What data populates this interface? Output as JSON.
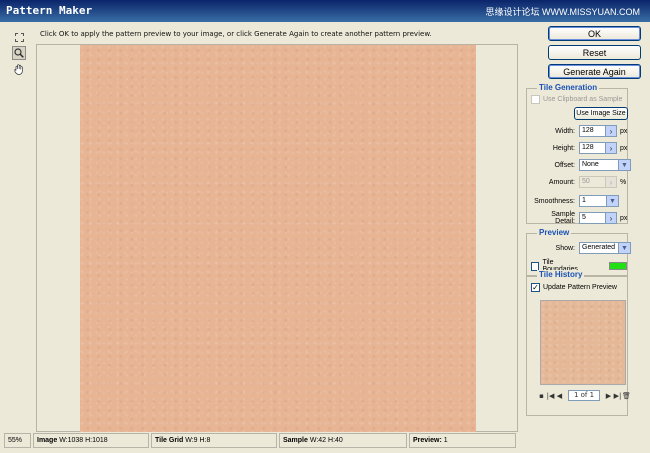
{
  "window": {
    "title": "Pattern Maker",
    "watermark": "思缘设计论坛  WWW.MISSYUAN.COM"
  },
  "toolbar": {
    "tools": [
      {
        "name": "rectangular-marquee-icon",
        "selected": false
      },
      {
        "name": "zoom-icon",
        "selected": true,
        "glyph": "🔍"
      },
      {
        "name": "hand-icon",
        "selected": false,
        "glyph": "✋"
      }
    ]
  },
  "hint": "Click OK to apply the pattern preview to your image, or click Generate Again to create another pattern preview.",
  "buttons": {
    "ok": "OK",
    "reset": "Reset",
    "generate_again": "Generate Again"
  },
  "tile_generation": {
    "title": "Tile Generation",
    "use_clipboard_label": "Use Clipboard as Sample",
    "use_clipboard_checked": false,
    "use_image_size": "Use Image Size",
    "width_label": "Width:",
    "width_value": "128",
    "width_unit": "px",
    "height_label": "Height:",
    "height_value": "128",
    "height_unit": "px",
    "offset_label": "Offset:",
    "offset_value": "None",
    "amount_label": "Amount:",
    "amount_value": "50",
    "amount_unit": "%",
    "smoothness_label": "Smoothness:",
    "smoothness_value": "1",
    "sample_detail_label": "Sample Detail:",
    "sample_detail_value": "5",
    "sample_detail_unit": "px"
  },
  "preview_group": {
    "title": "Preview",
    "show_label": "Show:",
    "show_value": "Generated",
    "tile_boundaries_label": "Tile Boundaries",
    "tile_boundaries_checked": false,
    "boundary_color": "#22e014"
  },
  "tile_history": {
    "title": "Tile History",
    "update_label": "Update Pattern Preview",
    "update_checked": true,
    "page": "1 of 1"
  },
  "status": {
    "zoom": "55%",
    "image_label": "Image",
    "image_value": "W:1038 H:1018",
    "tile_grid_label": "Tile Grid",
    "tile_grid_value": "W:9 H:8",
    "sample_label": "Sample",
    "sample_value": "W:42 H:40",
    "preview_label": "Preview:",
    "preview_value": "1"
  },
  "colors": {
    "pattern": "#e7b494",
    "accent": "#1a52b8"
  }
}
